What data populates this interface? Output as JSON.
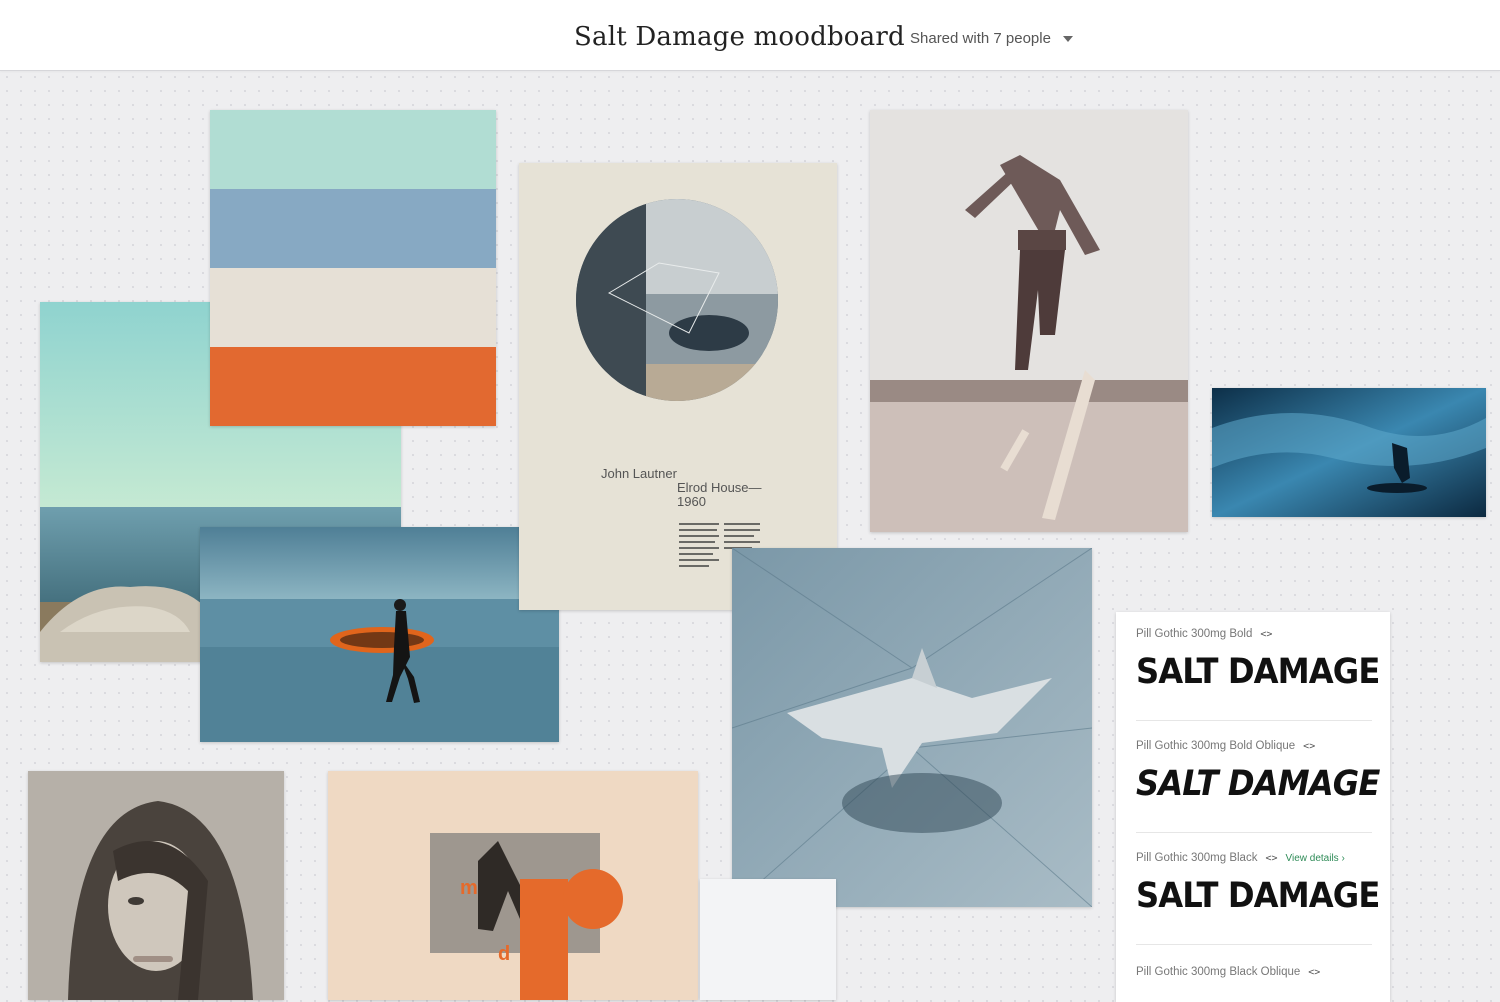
{
  "header": {
    "title": "Salt Damage moodboard",
    "share_label": "Shared with 7 people"
  },
  "palette": {
    "colors": [
      "#b1ddd3",
      "#87a9c3",
      "#e6e0d6",
      "#e26930"
    ]
  },
  "poster": {
    "architect": "John Lautner",
    "project": "Elrod House—",
    "year": "1960"
  },
  "collage": {
    "letter_m": "m",
    "letter_d": "d"
  },
  "fonts": {
    "items": [
      {
        "name": "Pill Gothic 300mg Bold",
        "code": "<>",
        "sample": "SALT DAMAGE"
      },
      {
        "name": "Pill Gothic 300mg Bold Oblique",
        "code": "<>",
        "sample": "SALT DAMAGE"
      },
      {
        "name": "Pill Gothic 300mg Black",
        "code": "<>",
        "link": "View details ›",
        "sample": "SALT DAMAGE"
      },
      {
        "name": "Pill Gothic 300mg Black Oblique",
        "code": "<>"
      }
    ]
  }
}
